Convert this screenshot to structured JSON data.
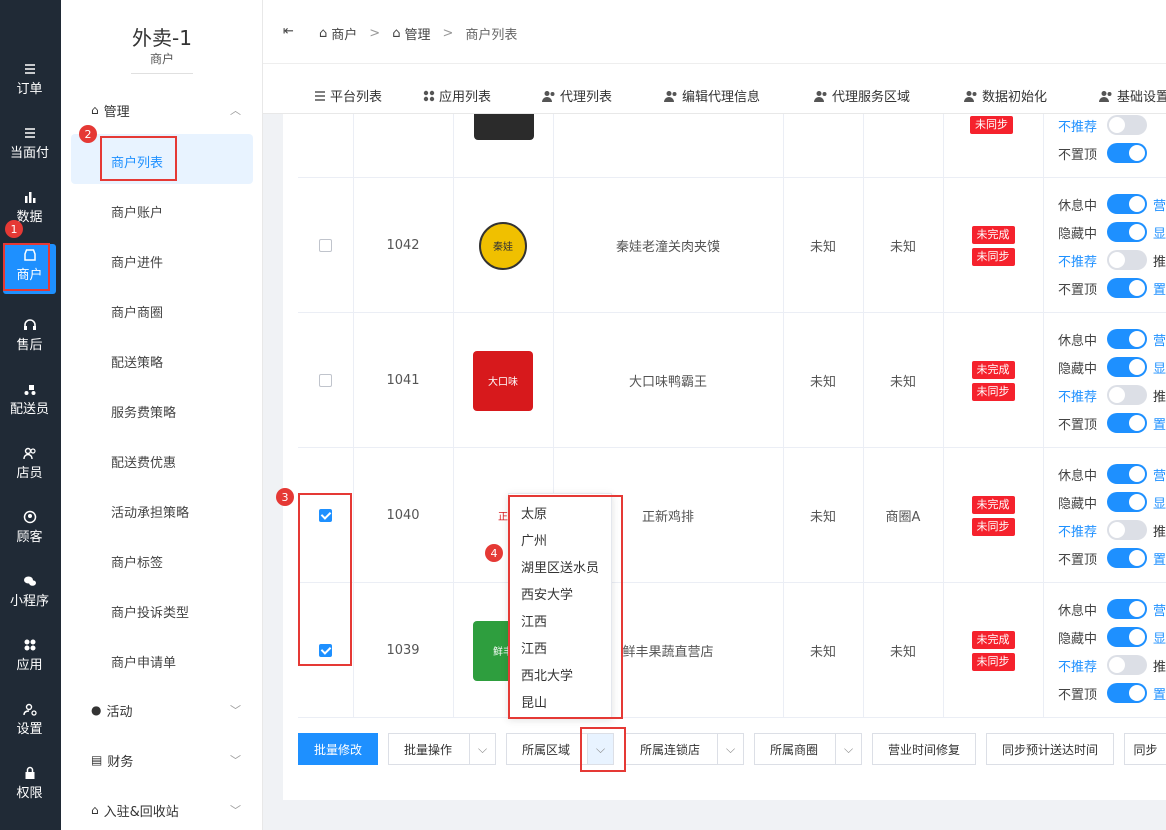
{
  "rail": {
    "items": [
      {
        "label": "订单",
        "icon": "list-icon"
      },
      {
        "label": "当面付",
        "icon": "list-icon"
      },
      {
        "label": "数据",
        "icon": "bar-chart-icon"
      },
      {
        "label": "商户",
        "icon": "store-icon"
      },
      {
        "label": "售后",
        "icon": "headset-icon"
      },
      {
        "label": "配送员",
        "icon": "scooter-icon"
      },
      {
        "label": "店员",
        "icon": "users-icon"
      },
      {
        "label": "顾客",
        "icon": "user-circle-icon"
      },
      {
        "label": "小程序",
        "icon": "wechat-icon"
      },
      {
        "label": "应用",
        "icon": "apps-icon"
      },
      {
        "label": "设置",
        "icon": "settings-user-icon"
      },
      {
        "label": "权限",
        "icon": "lock-icon"
      }
    ]
  },
  "subnav": {
    "brand": "外卖-1",
    "brand_sub": "商户",
    "group_manage": "管理",
    "items": [
      "商户列表",
      "商户账户",
      "商户进件",
      "商户商圈",
      "配送策略",
      "服务费策略",
      "配送费优惠",
      "活动承担策略",
      "商户标签",
      "商户投诉类型",
      "商户申请单"
    ],
    "group_activity": "活动",
    "group_finance": "财务",
    "group_entry": "入驻&回收站"
  },
  "breadcrumb": [
    "商户",
    "管理",
    "商户列表"
  ],
  "breadcrumb_sep": ">",
  "tabs": [
    "平台列表",
    "应用列表",
    "代理列表",
    "编辑代理信息",
    "代理服务区域",
    "数据初始化",
    "基础设置"
  ],
  "rows": [
    {
      "id": "1042",
      "name": "秦娃老潼关肉夹馍",
      "c1": "未知",
      "c2": "未知",
      "tags": [
        "未完成",
        "未同步"
      ],
      "logo_text": "秦娃",
      "logo_color": "#f0c000"
    },
    {
      "id": "1041",
      "name": "大口味鸭霸王",
      "c1": "未知",
      "c2": "未知",
      "tags": [
        "未完成",
        "未同步"
      ],
      "logo_text": "大口味",
      "logo_color": "#d7191c"
    },
    {
      "id": "1040",
      "name": "正新鸡排",
      "c1": "未知",
      "c2": "商圈A",
      "tags": [
        "未完成",
        "未同步"
      ],
      "logo_text": "正",
      "logo_color": "#ffffff"
    },
    {
      "id": "1039",
      "name": "鲜丰果蔬直营店",
      "c1": "未知",
      "c2": "未知",
      "tags": [
        "未完成",
        "未同步"
      ],
      "logo_text": "鲜丰",
      "logo_color": "#2e9e3e"
    }
  ],
  "top_row_tag": "未同步",
  "switches": {
    "resting": "休息中",
    "hidden": "隐藏中",
    "not_recommended": "不推荐",
    "not_pinned": "不置顶"
  },
  "switch_side_labels": [
    "营",
    "显",
    "推",
    "置"
  ],
  "dropdown_items": [
    "太原",
    "广州",
    "湖里区送水员",
    "西安大学",
    "江西",
    "江西",
    "西北大学",
    "昆山"
  ],
  "buttons": {
    "batch_edit": "批量修改",
    "batch_op": "批量操作",
    "region": "所属区域",
    "chain": "所属连锁店",
    "circle": "所属商圈",
    "hours_fix": "营业时间修复",
    "sync_eta": "同步预计送达时间",
    "sync_more": "同步"
  },
  "annotations": [
    "1",
    "2",
    "3",
    "4"
  ],
  "colors": {
    "accent": "#1e90ff",
    "danger": "#f5222d",
    "rail": "#202a36",
    "annotation": "#e53935"
  }
}
